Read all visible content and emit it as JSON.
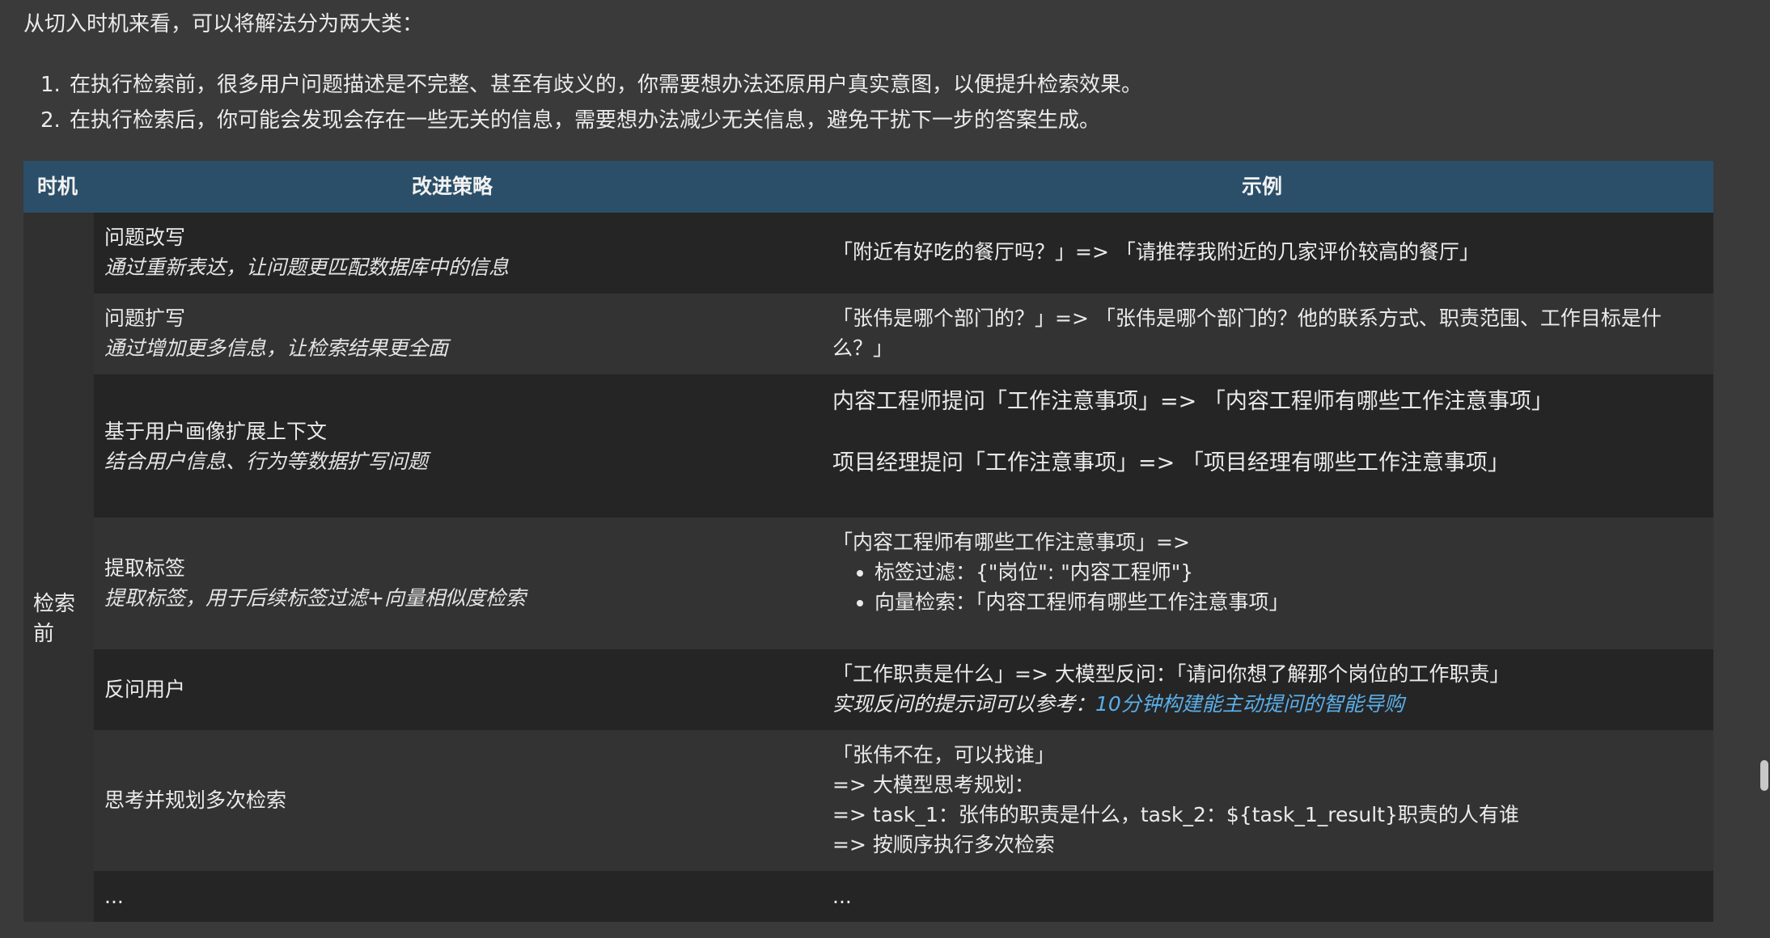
{
  "intro": "从切入时机来看，可以将解法分为两大类：",
  "list": [
    {
      "num": "1.",
      "text": "在执行检索前，很多用户问题描述是不完整、甚至有歧义的，你需要想办法还原用户真实意图，以便提升检索效果。"
    },
    {
      "num": "2.",
      "text": "在执行检索后，你可能会发现会存在一些无关的信息，需要想办法减少无关信息，避免干扰下一步的答案生成。"
    }
  ],
  "table": {
    "headers": {
      "time": "时机",
      "strategy": "改进策略",
      "example": "示例"
    },
    "time_label": "检索前",
    "rows": [
      {
        "title": "问题改写",
        "subtitle": "通过重新表达，让问题更匹配数据库中的信息",
        "example": [
          "「附近有好吃的餐厅吗？」=> 「请推荐我附近的几家评价较高的餐厅」"
        ]
      },
      {
        "title": "问题扩写",
        "subtitle": "通过增加更多信息，让检索结果更全面",
        "example": [
          "「张伟是哪个部门的？」=> 「张伟是哪个部门的？他的联系方式、职责范围、工作目标是什",
          "么？」"
        ]
      },
      {
        "title": "基于用户画像扩展上下文",
        "subtitle": "结合用户信息、行为等数据扩写问题",
        "example": [
          "内容工程师提问「工作注意事项」=> 「内容工程师有哪些工作注意事项」",
          "项目经理提问「工作注意事项」=> 「项目经理有哪些工作注意事项」"
        ]
      },
      {
        "title": "提取标签",
        "subtitle": "提取标签，用于后续标签过滤+向量相似度检索",
        "example_head": "「内容工程师有哪些工作注意事项」=>",
        "bullets": [
          "标签过滤：{\"岗位\": \"内容工程师\"}",
          "向量检索：「内容工程师有哪些工作注意事项」"
        ]
      },
      {
        "title": "反问用户",
        "subtitle": "",
        "example": [
          "「工作职责是什么」=> 大模型反问：「请问你想了解那个岗位的工作职责」"
        ],
        "ref_prefix": "实现反问的提示词可以参考：",
        "ref_link": "10分钟构建能主动提问的智能导购"
      },
      {
        "title": "思考并规划多次检索",
        "subtitle": "",
        "example": [
          "「张伟不在，可以找谁」",
          "=> 大模型思考规划：",
          "=> task_1：张伟的职责是什么，task_2：${task_1_result}职责的人有谁",
          "=> 按顺序执行多次检索"
        ]
      },
      {
        "title": "...",
        "subtitle": "",
        "example": [
          "..."
        ]
      }
    ]
  }
}
